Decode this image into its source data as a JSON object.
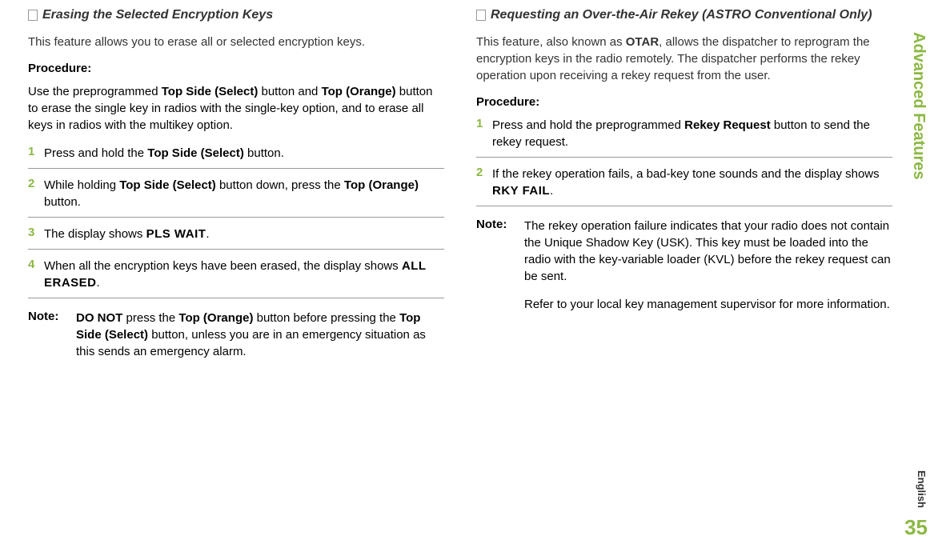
{
  "sideLabel": "Advanced Features",
  "englishLabel": "English",
  "pageNumber": "35",
  "left": {
    "title": "Erasing the Selected Encryption Keys",
    "intro": "This feature allows you to erase all or selected encryption keys.",
    "procedureLabel": "Procedure:",
    "procedureIntro_pre": "Use the preprogrammed ",
    "procedureIntro_b1": "Top Side (Select)",
    "procedureIntro_mid1": " button and ",
    "procedureIntro_b2": "Top (Orange)",
    "procedureIntro_post": " button to erase the single key in radios with the single-key option, and to erase all keys in radios with the multikey option.",
    "steps": [
      {
        "num": "1",
        "pre": "Press and hold the ",
        "b1": "Top Side (Select)",
        "post": " button."
      },
      {
        "num": "2",
        "pre": "While holding ",
        "b1": "Top Side (Select)",
        "mid": " button down, press the ",
        "b2": "Top (Orange)",
        "post": " button."
      },
      {
        "num": "3",
        "pre": "The display shows ",
        "disp": "PLS WAIT",
        "post": "."
      },
      {
        "num": "4",
        "pre": "When all the encryption keys have been erased, the display shows ",
        "disp": "ALL ERASED",
        "post": "."
      }
    ],
    "noteLabel": "Note:",
    "note_b1": "DO NOT",
    "note_mid1": " press the ",
    "note_b2": "Top (Orange)",
    "note_mid2": " button before pressing the ",
    "note_b3": "Top Side (Select)",
    "note_post": " button, unless you are in an emergency situation as this sends an emergency alarm."
  },
  "right": {
    "title": "Requesting an Over-the-Air Rekey (ASTRO Conventional Only)",
    "intro_pre": "This feature, also known as ",
    "intro_b1": "OTAR",
    "intro_post": ", allows the dispatcher to reprogram the encryption keys in the radio remotely. The dispatcher performs the rekey operation upon receiving a rekey request from the user.",
    "procedureLabel": "Procedure:",
    "steps": [
      {
        "num": "1",
        "pre": "Press and hold the preprogrammed ",
        "b1": "Rekey Request",
        "post": " button to send the rekey request."
      },
      {
        "num": "2",
        "pre": "If the rekey operation fails, a bad-key tone sounds and the display shows ",
        "disp": "RKY FAIL",
        "post": "."
      }
    ],
    "noteLabel": "Note:",
    "note_p1": "The rekey operation failure indicates that your radio does not contain the Unique Shadow Key (USK). This key must be loaded into the radio with the key-variable loader (KVL) before the rekey request can be sent.",
    "note_p2": "Refer to your local key management supervisor for more information."
  }
}
